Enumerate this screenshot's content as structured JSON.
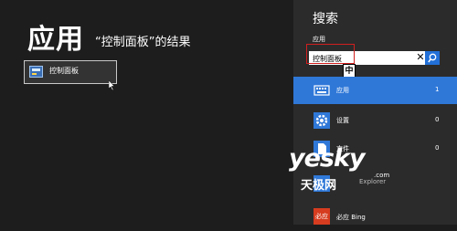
{
  "main": {
    "heading": "应用",
    "subtitle": "“控制面板”的结果",
    "result": {
      "label": "控制面板",
      "icon": "control-panel-icon"
    }
  },
  "search": {
    "title": "搜索",
    "scope": "应用",
    "value": "控制面板",
    "clear_icon": "close-icon",
    "submit_icon": "search-icon",
    "ime_indicator": "中",
    "categories": [
      {
        "label": "应用",
        "count": "1",
        "icon": "keyboard-icon",
        "selected": true
      },
      {
        "label": "设置",
        "count": "0",
        "icon": "gear-icon"
      },
      {
        "label": "文件",
        "count": "0",
        "icon": "document-icon"
      },
      {
        "label": "Explorer",
        "count": "",
        "icon": "ie-icon"
      },
      {
        "label": "必应 Bing",
        "count": "",
        "icon": "bing-icon",
        "icon_text": "必应"
      }
    ]
  },
  "watermark": {
    "main": "yesky",
    "com": ".com",
    "sub": "天极网"
  },
  "colors": {
    "accent": "#2f78d8",
    "highlight_box": "#d21f1f",
    "background": "#1d1d1d",
    "pane": "#2b2b2b"
  }
}
